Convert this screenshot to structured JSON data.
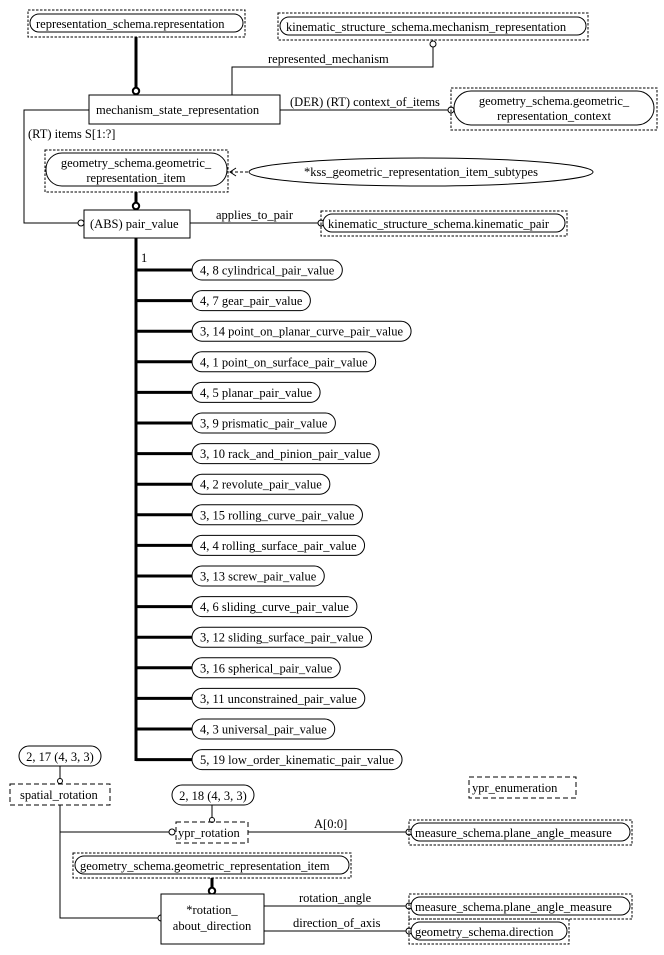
{
  "entities": {
    "representation": "representation_schema.representation",
    "mechanism_representation": "kinematic_structure_schema.mechanism_representation",
    "mechanism_state_representation": "mechanism_state_representation",
    "geometric_representation_context_line1": "geometry_schema.geometric_",
    "geometric_representation_context_line2": "representation_context",
    "geometric_representation_item_line1": "geometry_schema.geometric_",
    "geometric_representation_item_line2": "representation_item",
    "kss_subtypes": "*kss_geometric_representation_item_subtypes",
    "pair_value": "(ABS) pair_value",
    "kinematic_pair": "kinematic_structure_schema.kinematic_pair",
    "spatial_rotation_ref": "2, 17 (4, 3, 3)",
    "spatial_rotation": "spatial_rotation",
    "ypr_rotation_ref": "2, 18 (4, 3, 3)",
    "ypr_rotation": "ypr_rotation",
    "ypr_enumeration": "ypr_enumeration",
    "plane_angle_measure_1": "measure_schema.plane_angle_measure",
    "geometric_representation_item_full": "geometry_schema.geometric_representation_item",
    "rotation_about_direction_line1": "*rotation_",
    "rotation_about_direction_line2": "about_direction",
    "plane_angle_measure_2": "measure_schema.plane_angle_measure",
    "direction": "geometry_schema.direction"
  },
  "relations": {
    "represented_mechanism": "represented_mechanism",
    "context_of_items": "(DER) (RT) context_of_items",
    "items": "(RT) items S[1:?]",
    "applies_to_pair": "applies_to_pair",
    "subtype_cardinality": "1",
    "ypr_aggregate": "A[0:0]",
    "rotation_angle": "rotation_angle",
    "direction_of_axis": "direction_of_axis"
  },
  "subtypes": [
    "4, 8 cylindrical_pair_value",
    "4, 7 gear_pair_value",
    "3, 14 point_on_planar_curve_pair_value",
    "4, 1 point_on_surface_pair_value",
    "4, 5 planar_pair_value",
    "3, 9 prismatic_pair_value",
    "3, 10 rack_and_pinion_pair_value",
    "4, 2 revolute_pair_value",
    "3, 15 rolling_curve_pair_value",
    "4, 4 rolling_surface_pair_value",
    "3, 13 screw_pair_value",
    "4, 6 sliding_curve_pair_value",
    "3, 12 sliding_surface_pair_value",
    "3, 16 spherical_pair_value",
    "3, 11 unconstrained_pair_value",
    "4, 3 universal_pair_value",
    "5, 19 low_order_kinematic_pair_value"
  ]
}
